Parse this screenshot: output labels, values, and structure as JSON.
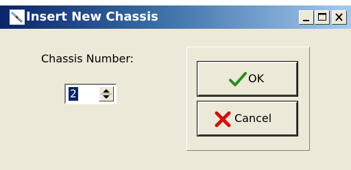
{
  "window": {
    "title": "Insert New Chassis",
    "buttons": {
      "minimize": "minimize",
      "maximize": "maximize",
      "close": "close"
    }
  },
  "form": {
    "chassis_label": "Chassis Number:",
    "chassis_value": "2"
  },
  "actions": {
    "ok_label": "OK",
    "cancel_label": "Cancel"
  },
  "colors": {
    "titlebar_start": "#0a246a",
    "titlebar_end": "#a6caf0",
    "dialog_bg": "#ece9d8",
    "ok_check": "#2e8b1e",
    "cancel_x": "#d01010"
  }
}
